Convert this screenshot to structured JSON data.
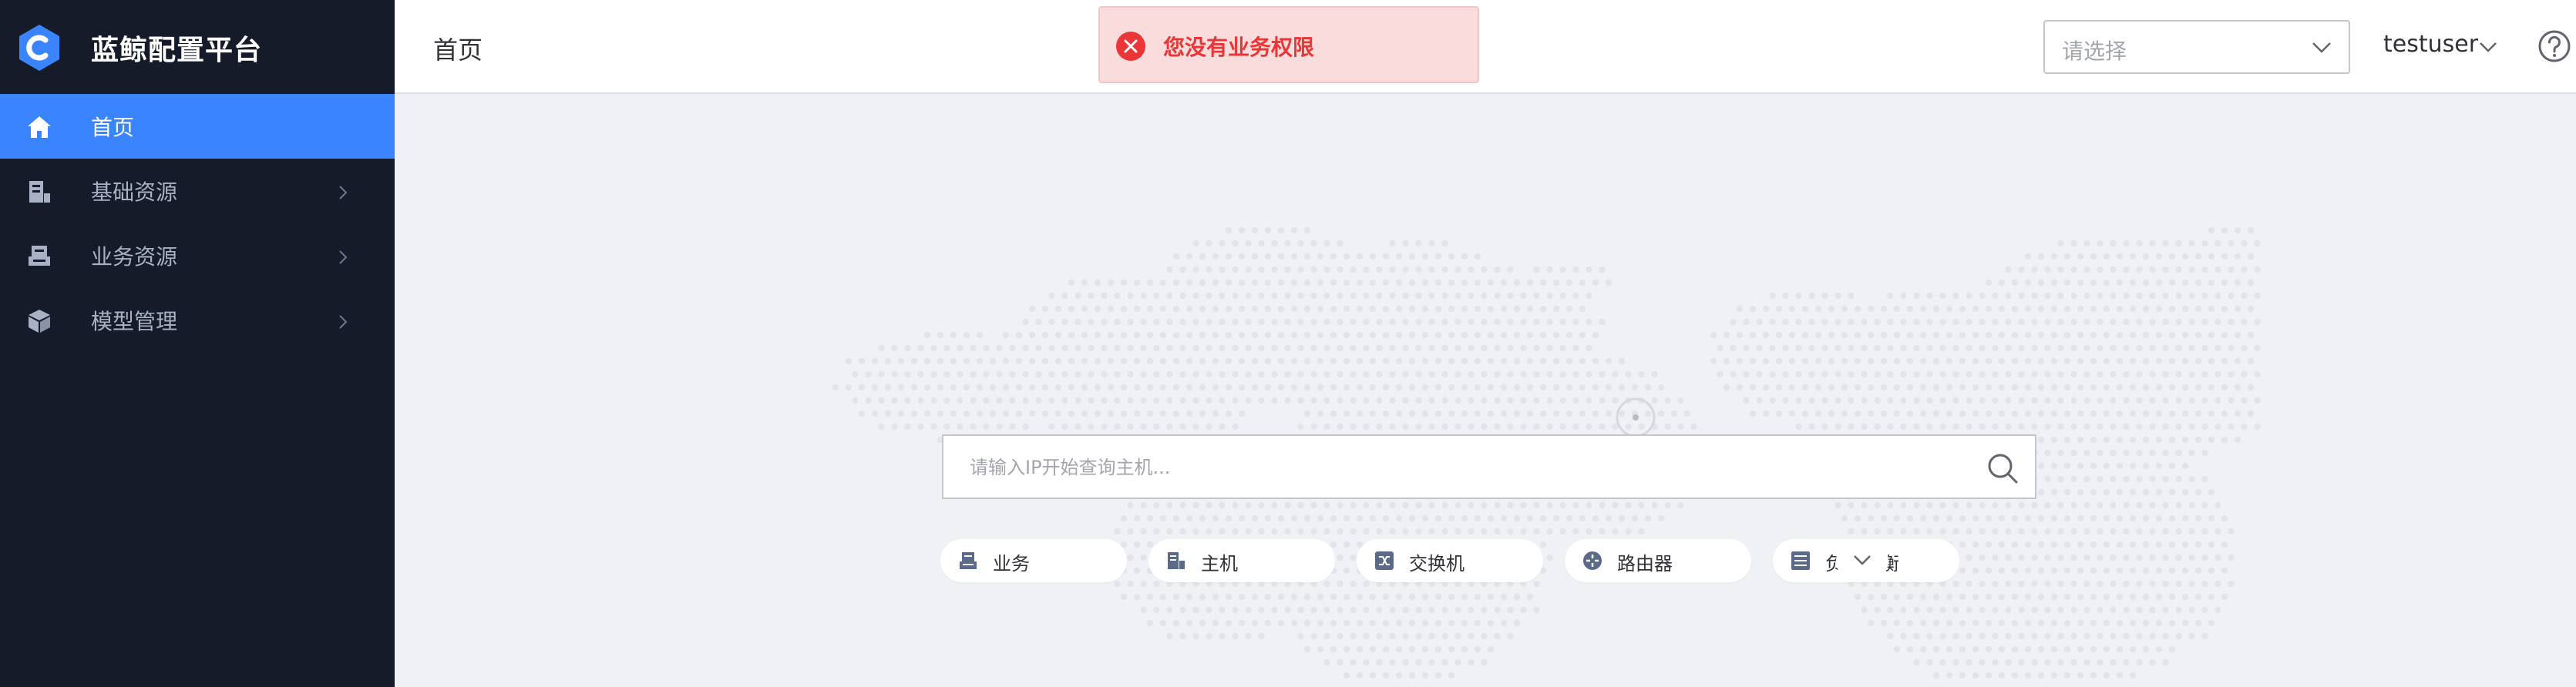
{
  "app": {
    "title": "蓝鲸配置平台",
    "logo_icon": "cmdb-logo-icon",
    "accent_color": "#3a84ff",
    "sidebar_bg": "#161b29"
  },
  "sidebar": {
    "items": [
      {
        "label": "首页",
        "icon": "home-icon",
        "active": true
      },
      {
        "label": "基础资源",
        "icon": "resource-icon",
        "active": false
      },
      {
        "label": "业务资源",
        "icon": "business-resource-icon",
        "active": false
      },
      {
        "label": "模型管理",
        "icon": "model-icon",
        "active": false
      }
    ]
  },
  "header": {
    "page_title": "首页",
    "business_select": {
      "placeholder": "请选择"
    },
    "username": "testuser"
  },
  "toast": {
    "type": "error",
    "message": "您没有业务权限",
    "color": "#ea3636"
  },
  "search": {
    "placeholder": "请输入IP开始查询主机..."
  },
  "quick_filters": [
    {
      "label": "业务",
      "icon": "business-icon"
    },
    {
      "label": "主机",
      "icon": "host-icon"
    },
    {
      "label": "交换机",
      "icon": "switch-icon"
    },
    {
      "label": "路由器",
      "icon": "router-icon"
    },
    {
      "label": "负载均衡",
      "icon": "load-balance-icon"
    }
  ]
}
